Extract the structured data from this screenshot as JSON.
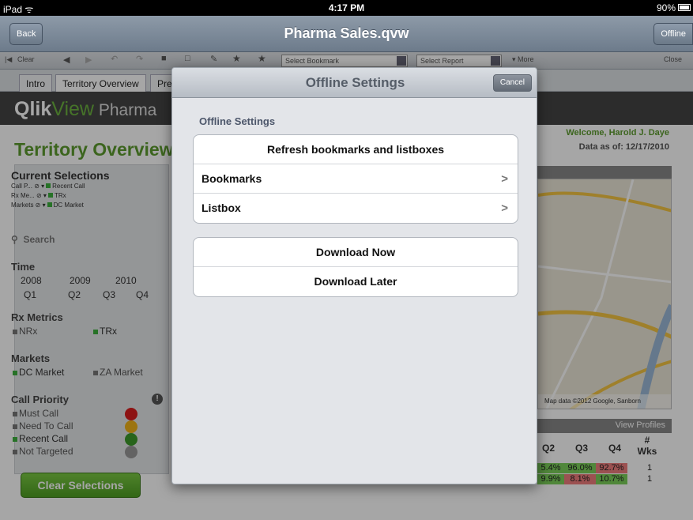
{
  "statusbar": {
    "device": "iPad ᯤ",
    "time": "4:17 PM",
    "battery": "90%"
  },
  "navbar": {
    "back_label": "Back",
    "title": "Pharma Sales.qvw",
    "offline_label": "Offline"
  },
  "toolbar": {
    "clear_label": "Clear",
    "bookmark_select": "Select Bookmark",
    "report_select": "Select Report",
    "more_label": "▾ More",
    "close_label": "Close"
  },
  "tabs": [
    "Intro",
    "Territory Overview",
    "Pre"
  ],
  "banner": {
    "logo_bold": "Qlik",
    "logo_rest": "View",
    "logo_suffix": " Pharma"
  },
  "page": {
    "title": "Territory Overview",
    "welcome": "Welcome, Harold J. Daye",
    "as_of": "Data as of: 12/17/2010"
  },
  "sidebar": {
    "current_selections_title": "Current Selections",
    "selections": [
      {
        "field": "Call P...",
        "value": "Recent Call"
      },
      {
        "field": "Rx Me...",
        "value": "TRx"
      },
      {
        "field": "Markets",
        "value": "DC Market"
      }
    ],
    "search_label": "Search",
    "time_title": "Time",
    "years": [
      "2008",
      "2009",
      "2010"
    ],
    "quarters": [
      "Q1",
      "Q2",
      "Q3",
      "Q4"
    ],
    "rx_title": "Rx Metrics",
    "rx_options": [
      "NRx",
      "TRx"
    ],
    "markets_title": "Markets",
    "markets_options": [
      "DC Market",
      "ZA Market"
    ],
    "call_priority_title": "Call Priority",
    "call_priority_options": [
      "Must Call",
      "Need To Call",
      "Recent Call",
      "Not Targeted"
    ],
    "clear_button": "Clear Selections"
  },
  "map": {
    "attribution": "Map data ©2012 Google, Sanborn"
  },
  "profiles": {
    "header": "View Profiles",
    "columns": [
      "Q2",
      "Q3",
      "Q4",
      "#\nWks"
    ],
    "rows": [
      [
        "5.4%",
        "96.0%",
        "92.7%",
        "1"
      ],
      [
        "9.9%",
        "8.1%",
        "10.7%",
        "1"
      ]
    ]
  },
  "popover": {
    "title": "Offline Settings",
    "cancel_label": "Cancel",
    "group_label": "Offline Settings",
    "refresh_row": "Refresh bookmarks and listboxes",
    "bookmarks_row": "Bookmarks",
    "listbox_row": "Listbox",
    "download_now": "Download Now",
    "download_later": "Download Later"
  },
  "colors": {
    "accent_green": "#5d9c2e",
    "overlay": "rgba(0,0,0,0.35)"
  }
}
